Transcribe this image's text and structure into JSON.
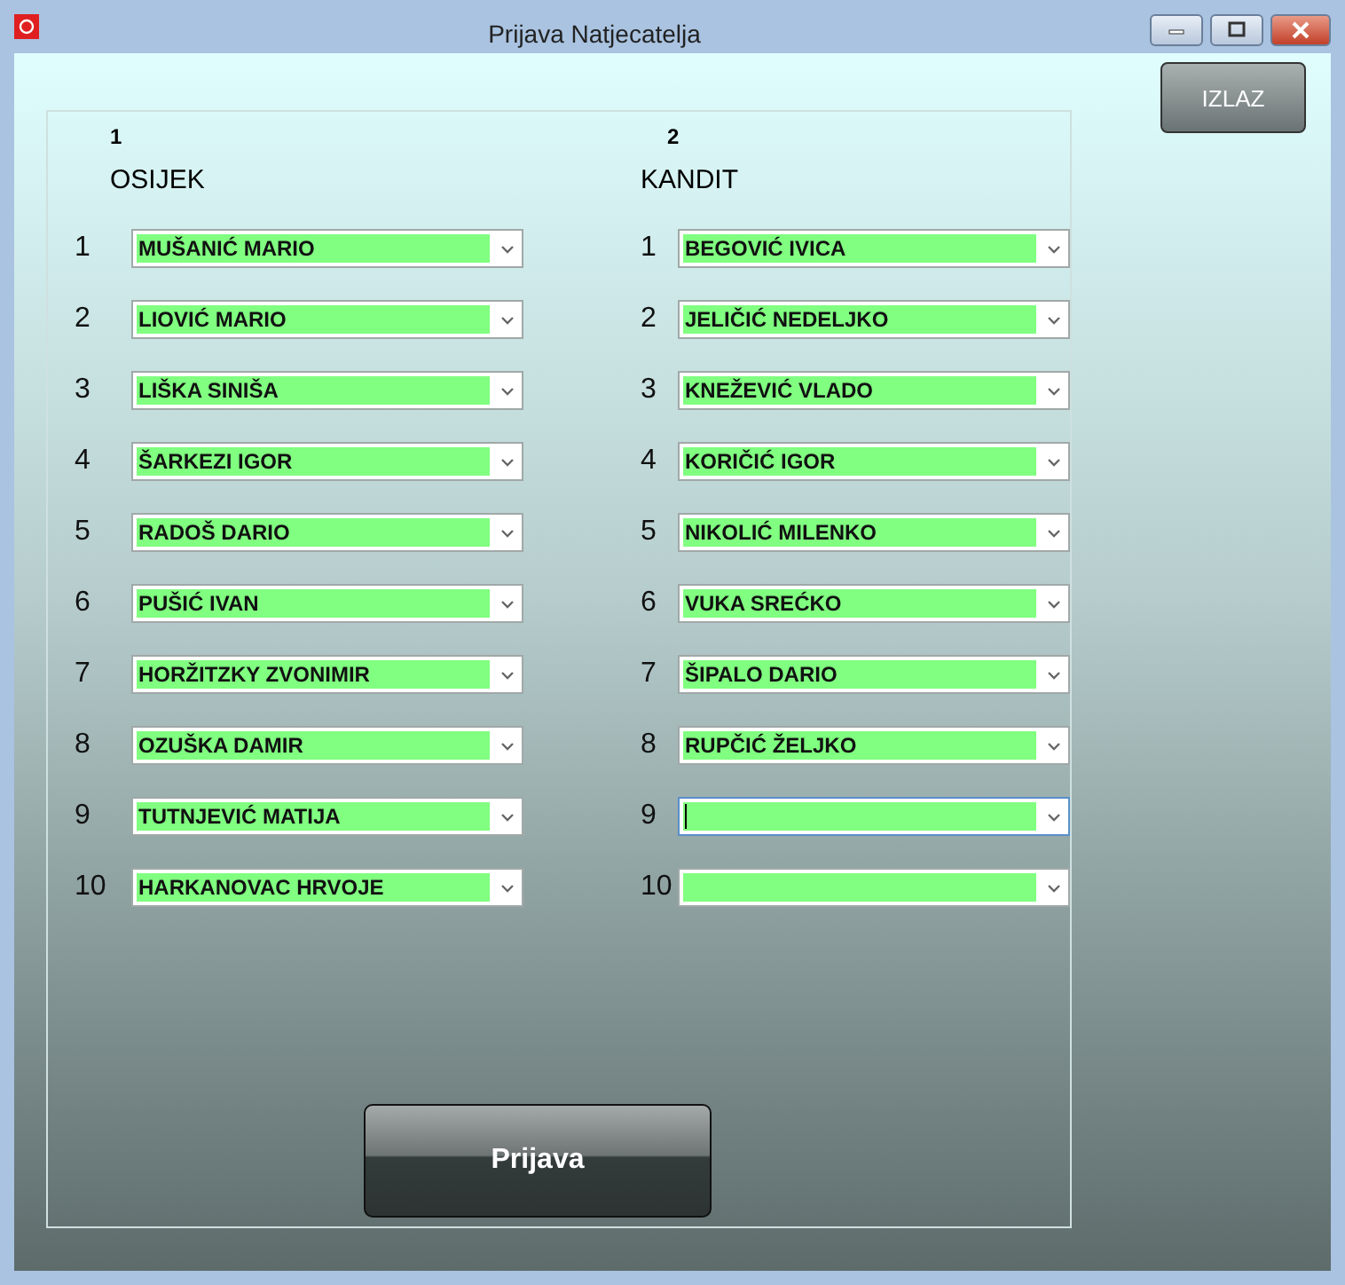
{
  "window": {
    "title": "Prijava Natjecatelja"
  },
  "exit_button": "IZLAZ",
  "columns": [
    {
      "number": "1",
      "heading": "OSIJEK",
      "rows": [
        {
          "number": "1",
          "value": "MUŠANIĆ MARIO",
          "focused": false
        },
        {
          "number": "2",
          "value": "LIOVIĆ MARIO",
          "focused": false
        },
        {
          "number": "3",
          "value": "LIŠKA SINIŠA",
          "focused": false
        },
        {
          "number": "4",
          "value": "ŠARKEZI IGOR",
          "focused": false
        },
        {
          "number": "5",
          "value": "RADOŠ DARIO",
          "focused": false
        },
        {
          "number": "6",
          "value": "PUŠIĆ IVAN",
          "focused": false
        },
        {
          "number": "7",
          "value": "HORŽITZKY ZVONIMIR",
          "focused": false
        },
        {
          "number": "8",
          "value": "OZUŠKA DAMIR",
          "focused": false
        },
        {
          "number": "9",
          "value": "TUTNJEVIĆ MATIJA",
          "focused": false
        },
        {
          "number": "10",
          "value": "HARKANOVAC HRVOJE",
          "focused": false
        }
      ]
    },
    {
      "number": "2",
      "heading": "KANDIT",
      "rows": [
        {
          "number": "1",
          "value": "BEGOVIĆ IVICA",
          "focused": false
        },
        {
          "number": "2",
          "value": "JELIČIĆ NEDELJKO",
          "focused": false
        },
        {
          "number": "3",
          "value": "KNEŽEVIĆ VLADO",
          "focused": false
        },
        {
          "number": "4",
          "value": "KORIČIĆ IGOR",
          "focused": false
        },
        {
          "number": "5",
          "value": "NIKOLIĆ MILENKO",
          "focused": false
        },
        {
          "number": "6",
          "value": "VUKA SREĆKO",
          "focused": false
        },
        {
          "number": "7",
          "value": "ŠIPALO DARIO",
          "focused": false
        },
        {
          "number": "8",
          "value": "RUPČIĆ ŽELJKO",
          "focused": false
        },
        {
          "number": "9",
          "focused": true
        },
        {
          "number": "10",
          "focused": false
        }
      ]
    }
  ],
  "submit_button": "Prijava"
}
